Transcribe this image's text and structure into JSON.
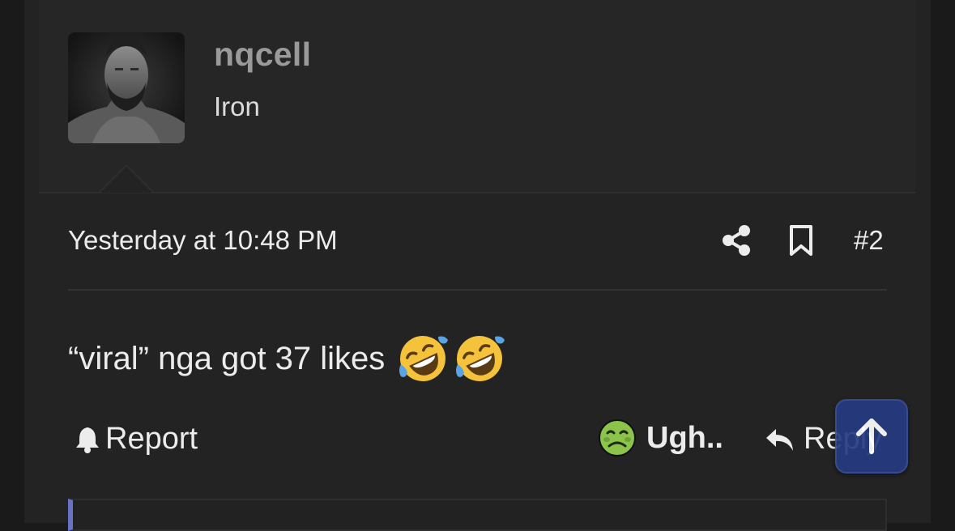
{
  "post": {
    "author": {
      "username": "nqcell",
      "title": "Iron",
      "avatar_icon": "avatar-photo"
    },
    "timestamp": "Yesterday at 10:48 PM",
    "post_number": "#2",
    "body_text": "“viral” nga got 37 likes",
    "body_emojis": [
      "rolling-on-floor-laughing-emoji",
      "rolling-on-floor-laughing-emoji"
    ]
  },
  "actions": {
    "report_label": "Report",
    "reaction_label": "Ugh..",
    "reaction_icon": "nauseated-face-emoji",
    "reply_label": "Reply"
  },
  "icons": {
    "share": "share-icon",
    "bookmark": "bookmark-icon",
    "bell": "bell-icon",
    "reply": "reply-icon",
    "scroll_top": "arrow-up-icon"
  },
  "colors": {
    "background": "#1a1a1a",
    "panel": "#232323",
    "username": "#9a9a9a",
    "text": "#ececec",
    "accent_button": "#263b82",
    "quote_bar": "#6a71c4"
  }
}
